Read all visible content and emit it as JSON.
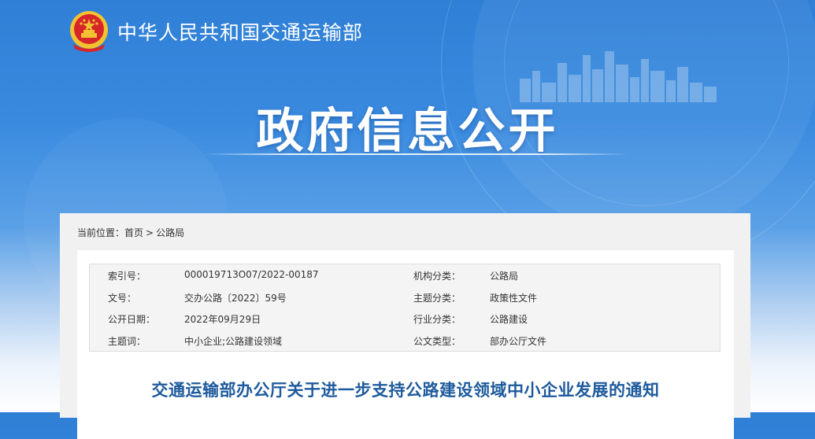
{
  "header": {
    "site_title": "中华人民共和国交通运输部",
    "emblem_icon": "national-emblem-icon"
  },
  "banner": {
    "title": "政府信息公开"
  },
  "breadcrumb": {
    "prefix": "当前位置：",
    "items": [
      "首页",
      "公路局"
    ],
    "separator": ">"
  },
  "meta": {
    "rows": [
      {
        "k1": "索引号：",
        "v1": "000019713O07/2022-00187",
        "k2": "机构分类：",
        "v2": "公路局"
      },
      {
        "k1": "文号：",
        "v1": "交办公路〔2022〕59号",
        "k2": "主题分类：",
        "v2": "政策性文件"
      },
      {
        "k1": "公开日期：",
        "v1": "2022年09月29日",
        "k2": "行业分类：",
        "v2": "公路建设"
      },
      {
        "k1": "主题词：",
        "v1": "中小企业;公路建设领域",
        "k2": "公文类型：",
        "v2": "部办公厅文件"
      }
    ]
  },
  "document": {
    "title": "交通运输部办公厅关于进一步支持公路建设领域中小企业发展的通知"
  },
  "colors": {
    "banner_blue": "#3a8be0",
    "title_blue": "#1d5a9c",
    "emblem_red": "#d6262a",
    "emblem_gold": "#f2c230"
  }
}
